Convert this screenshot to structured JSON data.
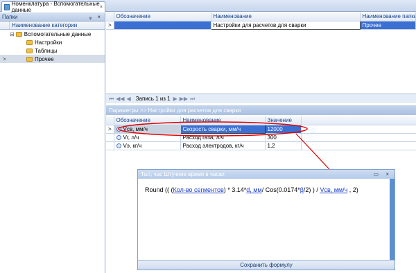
{
  "window": {
    "tab_title": "Номенклатура - Вспомогательные данные",
    "tab_close": "×"
  },
  "left_panel": {
    "title": "Папки",
    "controls": "ᵩ ×",
    "column_header": "Наименование категории",
    "tree": [
      {
        "label": "Вспомогательные данные",
        "expander": "⊟"
      },
      {
        "label": "Настройки"
      },
      {
        "label": "Таблицы"
      },
      {
        "label": "Прочее",
        "selected": true
      }
    ],
    "row_indicator": ">"
  },
  "main_grid": {
    "columns": [
      "Обозначение",
      "Наименование",
      "Наименование папки"
    ],
    "rows": [
      {
        "indicator": ">",
        "designation": "",
        "name": "Настройки для расчетов для сварки",
        "folder": "Прочее"
      }
    ]
  },
  "navigator": {
    "first": "⏮",
    "prev_page": "◀◀",
    "prev": "◀",
    "text": "Запись 1 из 1",
    "next": "▶",
    "next_page": "▶▶",
    "last": "⏭"
  },
  "params": {
    "header": "Параметры >> Настройки для расчетов для сварки",
    "columns": [
      "Обозначение",
      "Наименование",
      "Значение"
    ],
    "rows": [
      {
        "indicator": ">",
        "designation": "Vсв, мм/ч",
        "name": "Скорость сварки, мм/ч",
        "value": "12000"
      },
      {
        "indicator": "",
        "designation": "Vг, л/ч",
        "name": "Расход газа, л/ч",
        "value": "300"
      },
      {
        "indicator": "",
        "designation": "Vэ, кг/ч",
        "name": "Расход электродов, кг/ч",
        "value": "1,2"
      }
    ]
  },
  "dialog": {
    "title": "Тшт, час Штучное время в часах",
    "controls": "▭ ×",
    "formula": {
      "p1": "Round (( (",
      "l1": "Кол-во сегментов",
      "p2": ") * 3.14*",
      "l2": "d, мм",
      "p3": "/ Cos(0.0174*",
      "l3": "β",
      "p4": "/2) ) / ",
      "l4": "Vсв, мм/ч",
      "p5": " , 2)"
    },
    "save_button": "Сохранить формулу"
  },
  "colors": {
    "selection": "#3b6fd1",
    "highlight_ellipse": "#e00000",
    "link": "#1a3fd0"
  }
}
